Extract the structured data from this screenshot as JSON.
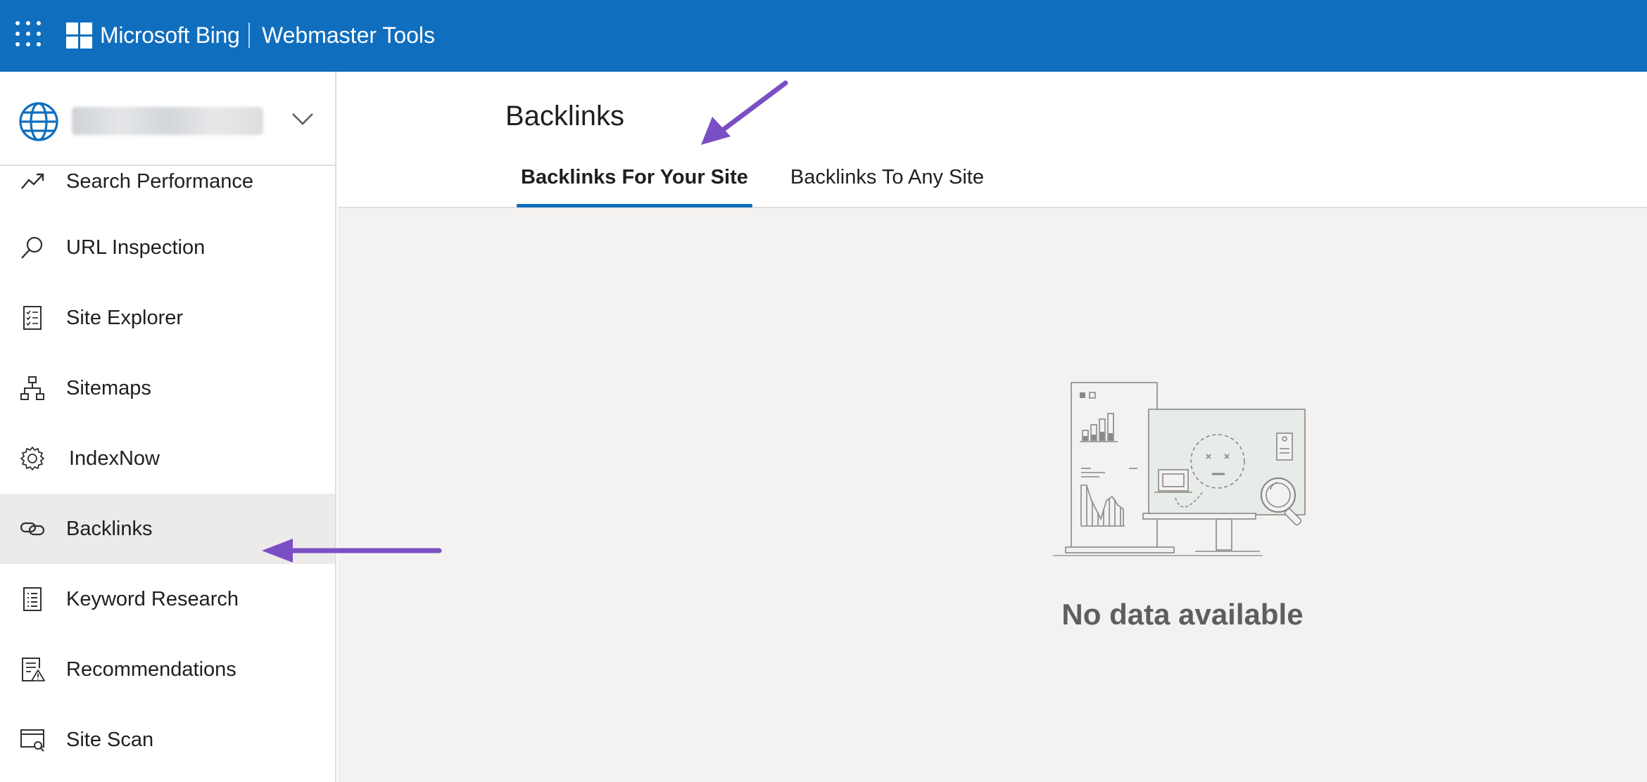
{
  "header": {
    "brand": "Microsoft Bing",
    "product": "Webmaster Tools",
    "accent_color": "#106ebe",
    "waffle_icon": "app-launcher-icon"
  },
  "sidebar": {
    "site_picker": {
      "site_name": "",
      "icon": "globe-icon"
    },
    "items": [
      {
        "label": "Search Performance",
        "icon": "trend-line-icon"
      },
      {
        "label": "URL Inspection",
        "icon": "search-icon"
      },
      {
        "label": "Site Explorer",
        "icon": "checklist-icon"
      },
      {
        "label": "Sitemaps",
        "icon": "sitemap-icon"
      },
      {
        "label": "IndexNow",
        "icon": "gear-icon"
      },
      {
        "label": "Backlinks",
        "icon": "link-icon",
        "active": true
      },
      {
        "label": "Keyword Research",
        "icon": "document-list-icon"
      },
      {
        "label": "Recommendations",
        "icon": "document-warning-icon"
      },
      {
        "label": "Site Scan",
        "icon": "browser-scan-icon"
      }
    ]
  },
  "main": {
    "title": "Backlinks",
    "tabs": [
      {
        "label": "Backlinks For Your Site",
        "selected": true
      },
      {
        "label": "Backlinks To Any Site",
        "selected": false
      }
    ],
    "empty_state": {
      "message": "No data available",
      "illustration": "empty-dashboard-illustration"
    }
  },
  "annotations": {
    "arrow_color": "#7b4fc4"
  }
}
